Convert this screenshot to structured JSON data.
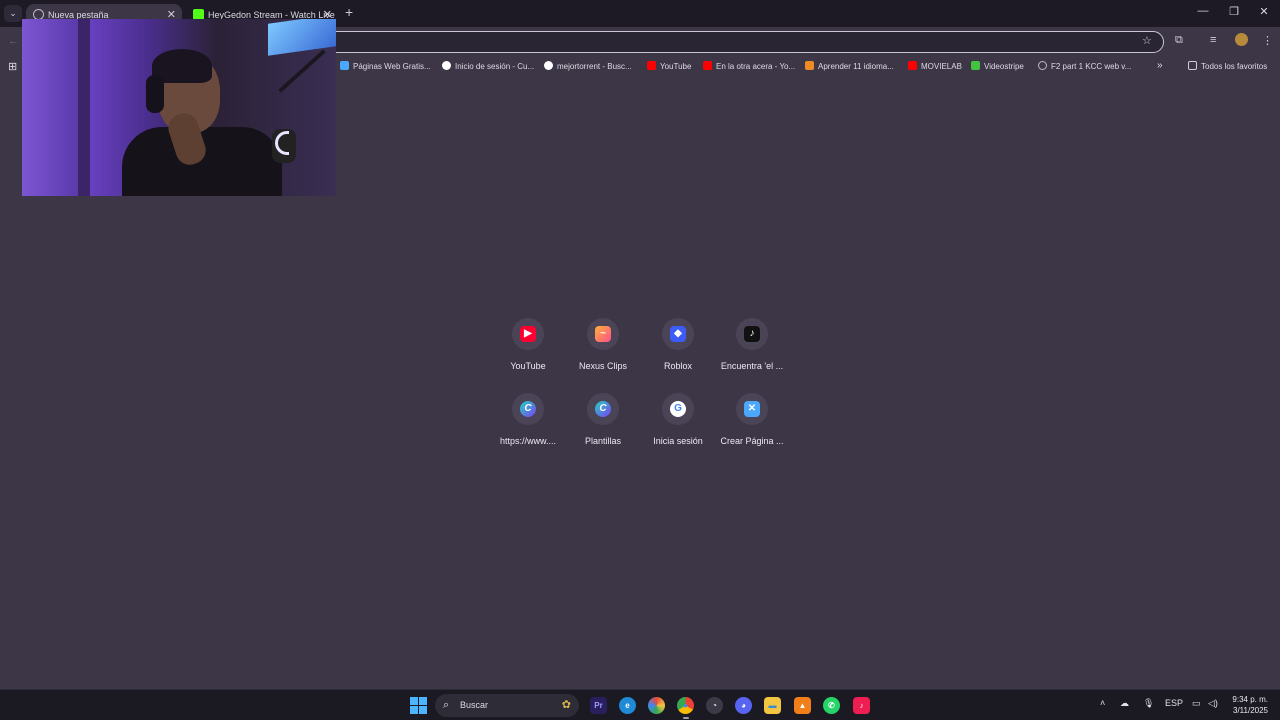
{
  "tabs": [
    {
      "title": "Nueva pestaña",
      "active": true
    },
    {
      "title": "HeyGedon Stream - Watch Live",
      "active": false
    }
  ],
  "toolbar": {
    "omnibox_value": ""
  },
  "bookmarks": [
    {
      "label": "Páginas Web Gratis...",
      "icon": "wix-icon",
      "color": "#4aa8ff"
    },
    {
      "label": "Inicio de sesión - Cu...",
      "icon": "google-icon",
      "color": "#ffffff"
    },
    {
      "label": "mejortorrent - Busc...",
      "icon": "google-icon",
      "color": "#ffffff"
    },
    {
      "label": "YouTube",
      "icon": "youtube-icon",
      "color": "#ff0000"
    },
    {
      "label": "En la otra acera - Yo...",
      "icon": "youtube-icon",
      "color": "#ff0000"
    },
    {
      "label": "Aprender 11 idioma...",
      "icon": "lingq-icon",
      "color": "#f08a24"
    },
    {
      "label": "MOVIELAB",
      "icon": "youtube-icon",
      "color": "#ff0000"
    },
    {
      "label": "Videostripe",
      "icon": "videostripe-icon",
      "color": "#44c242"
    },
    {
      "label": "F2 part 1 KCC web v...",
      "icon": "globe-icon",
      "color": "#bdb9c6"
    }
  ],
  "bookmarks_folder": "Todos los favoritos",
  "shortcuts": [
    {
      "label": "YouTube",
      "icon": "youtube-icon",
      "color": "#ff0033"
    },
    {
      "label": "Nexus Clips",
      "icon": "nexus-clips-icon",
      "color": "#ff6b8a"
    },
    {
      "label": "Roblox",
      "icon": "roblox-icon",
      "color": "#3d5bf5"
    },
    {
      "label": "Encuentra 'el ...",
      "icon": "tiktok-icon",
      "color": "#111111"
    },
    {
      "label": "https://www....",
      "icon": "canva-icon",
      "color": "#22b7d6"
    },
    {
      "label": "Plantillas",
      "icon": "canva-icon",
      "color": "#22b7d6"
    },
    {
      "label": "Inicia sesión",
      "icon": "google-icon",
      "color": "#ffffff"
    },
    {
      "label": "Crear Página ...",
      "icon": "wix-icon",
      "color": "#4aa8ff"
    }
  ],
  "taskbar": {
    "search_placeholder": "Buscar",
    "apps": [
      {
        "name": "premiere-pro-icon",
        "text": "Pr",
        "color": "#2a1f5e"
      },
      {
        "name": "edge-icon",
        "text": "e",
        "color": "#1f8ad6"
      },
      {
        "name": "davinci-icon",
        "text": "◉",
        "color": "#d64a3a"
      },
      {
        "name": "chrome-icon",
        "text": "●",
        "color": "#34a853"
      },
      {
        "name": "clock-app-icon",
        "text": "◔",
        "color": "#3c3a46"
      },
      {
        "name": "discord-icon",
        "text": "◕",
        "color": "#5865f2"
      },
      {
        "name": "file-explorer-icon",
        "text": "▬",
        "color": "#f4c542"
      },
      {
        "name": "vlc-icon",
        "text": "▲",
        "color": "#f07f1a"
      },
      {
        "name": "whatsapp-icon",
        "text": "✆",
        "color": "#25d366"
      },
      {
        "name": "tiktok-icon",
        "text": "♪",
        "color": "#ee1d52"
      }
    ],
    "language": "ESP",
    "time": "9:34 p. m.",
    "date": "3/11/2025"
  }
}
